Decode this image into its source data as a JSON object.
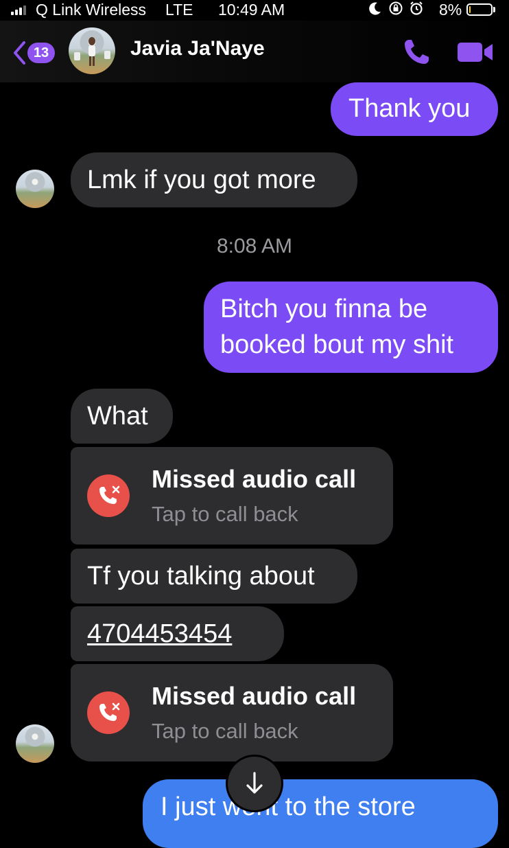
{
  "status_bar": {
    "carrier": "Q Link Wireless",
    "network": "LTE",
    "time": "10:49 AM",
    "battery_percent": "8%",
    "battery_level": 0.08,
    "icons": [
      "moon-icon",
      "orientation-lock-icon",
      "alarm-icon"
    ]
  },
  "header": {
    "back_count": "13",
    "contact_name": "Javia Ja'Naye",
    "accent_color": "#8f53f0"
  },
  "messages": {
    "thank_you": "Thank you",
    "lmk": "Lmk if you got more",
    "timestamp": "8:08 AM",
    "bitch": "Bitch you finna be booked bout my shit",
    "what": "What",
    "missed_call_1": {
      "title": "Missed audio call",
      "subtitle": "Tap to call back"
    },
    "tf": "Tf you talking about",
    "phone": "4704453454",
    "missed_call_2": {
      "title": "Missed audio call",
      "subtitle": "Tap to call back"
    },
    "store": "I just went to the store"
  },
  "colors": {
    "outgoing_bubble": "#7b4bf5",
    "incoming_bubble": "#2d2d2f",
    "missed_call": "#e8504a",
    "latest_outgoing": "#3f7ff0"
  }
}
